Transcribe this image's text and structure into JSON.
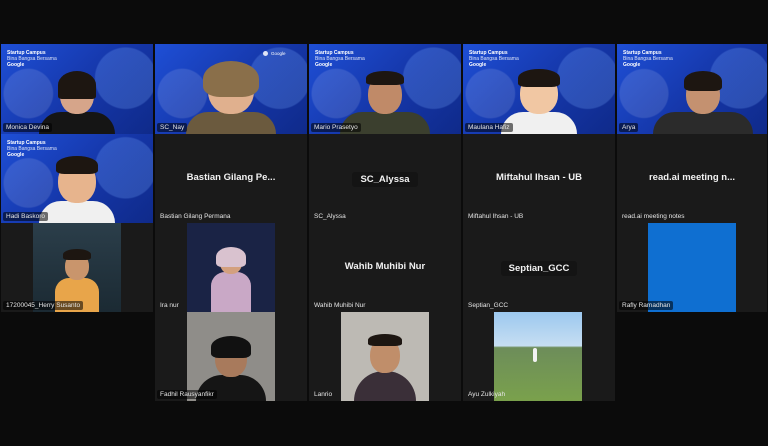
{
  "meeting": {
    "brand": {
      "title": "Startup Campus",
      "subtitle": "Bina Bangsa Bersama",
      "partner": "Google",
      "right_label": "Google Career Certificates"
    },
    "participants": [
      {
        "name": "Monica Devina",
        "mode": "video-branded"
      },
      {
        "name": "SC_Nay",
        "mode": "video-branded"
      },
      {
        "name": "Mario Prasetyo",
        "mode": "video-branded"
      },
      {
        "name": "Maulana Hafiz",
        "mode": "video-branded"
      },
      {
        "name": "Arya",
        "mode": "video-branded"
      },
      {
        "name": "Hadi Baskoro",
        "mode": "video-branded"
      },
      {
        "name": "Bastian Gilang Permana",
        "display": "Bastian Gilang Pe...",
        "mode": "name-only"
      },
      {
        "name": "SC_Alyssa",
        "display": "SC_Alyssa",
        "mode": "name-only"
      },
      {
        "name": "Miftahul Ihsan - UB",
        "display": "Miftahul Ihsan - UB",
        "mode": "name-only"
      },
      {
        "name": "read.ai meeting notes",
        "display": "read.ai meeting n...",
        "mode": "name-only"
      },
      {
        "name": "17200045_Herry Susanto",
        "mode": "video"
      },
      {
        "name": "Ira nur",
        "mode": "video"
      },
      {
        "name": "Wahib Muhibi Nur",
        "display": "Wahib Muhibi Nur",
        "mode": "name-only"
      },
      {
        "name": "Septian_GCC",
        "display": "Septian_GCC",
        "mode": "name-only"
      },
      {
        "name": "Rafly Ramadhan",
        "mode": "video"
      },
      {
        "name": "Fadhil Rausyanfikr",
        "mode": "video"
      },
      {
        "name": "Lanrio",
        "mode": "video"
      },
      {
        "name": "Ayu Zulkiyah",
        "mode": "video"
      }
    ]
  },
  "colors": {
    "branded_bg": "#1e4fd6",
    "tile_bg": "#1a1a1a",
    "page_bg": "#0b0b0b"
  }
}
